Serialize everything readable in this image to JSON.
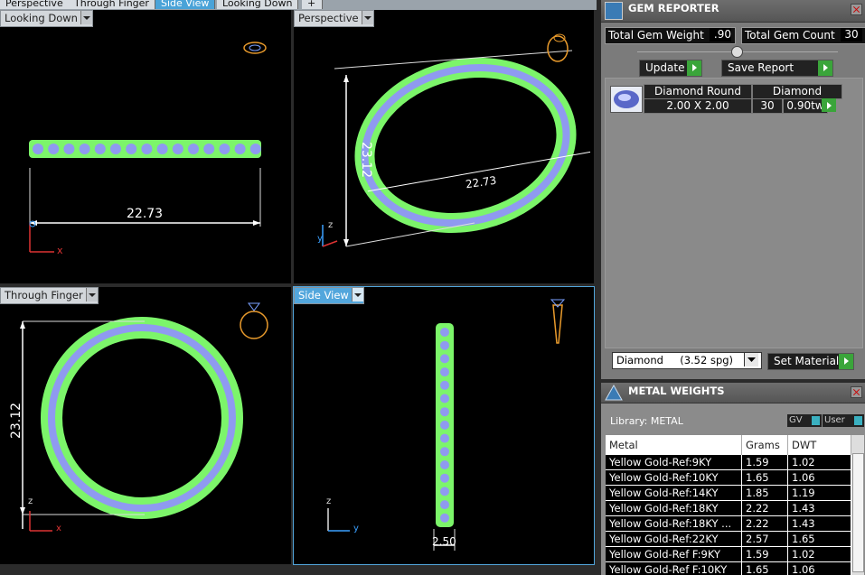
{
  "tabs": [
    {
      "label": "Perspective",
      "active": false
    },
    {
      "label": "Through Finger",
      "active": false
    },
    {
      "label": "Side View",
      "active": true
    },
    {
      "label": "Looking Down",
      "active": false
    }
  ],
  "viewports": {
    "top_left": {
      "label": "Looking Down",
      "dimension": "22.73",
      "axis_x": "x"
    },
    "top_right": {
      "label": "Perspective",
      "dimension_vertical": "23.12",
      "dimension_horizontal": "22.73",
      "axis_z": "z",
      "axis_y": "y"
    },
    "bottom_left": {
      "label": "Through Finger",
      "dimension": "23.12",
      "axis_z": "z",
      "axis_x": "x"
    },
    "bottom_right": {
      "label": "Side View",
      "dimension": "2.50",
      "axis_z": "z",
      "axis_y": "y"
    }
  },
  "gem_reporter": {
    "title": "GEM REPORTER",
    "total_weight_label": "Total Gem Weight",
    "total_weight_value": ".90",
    "total_count_label": "Total Gem Count",
    "total_count_value": "30",
    "update_label": "Update",
    "save_label": "Save Report",
    "gem": {
      "shape": "Diamond Round",
      "material": "Diamond",
      "size": "2.00 X 2.00",
      "count": "30",
      "weight": "0.90tw"
    },
    "material_select": "Diamond     (3.52 spg)",
    "set_material_label": "Set Material"
  },
  "metal_weights": {
    "title": "METAL WEIGHTS",
    "library": "Library: METAL",
    "gv_label": "GV",
    "user_label": "User",
    "columns": [
      "Metal",
      "Grams",
      "DWT"
    ],
    "rows": [
      [
        "Yellow Gold-Ref:9KY",
        "1.59",
        "1.02"
      ],
      [
        "Yellow Gold-Ref:10KY",
        "1.65",
        "1.06"
      ],
      [
        "Yellow Gold-Ref:14KY",
        "1.85",
        "1.19"
      ],
      [
        "Yellow Gold-Ref:18KY",
        "2.22",
        "1.43"
      ],
      [
        "Yellow Gold-Ref:18KY ...",
        "2.22",
        "1.43"
      ],
      [
        "Yellow Gold-Ref:22KY",
        "2.57",
        "1.65"
      ],
      [
        "Yellow Gold-Ref F:9KY",
        "1.59",
        "1.02"
      ],
      [
        "Yellow Gold-Ref F:10KY",
        "1.65",
        "1.06"
      ]
    ]
  },
  "colors": {
    "ring": "#7cf56a",
    "gem": "#8f9af0",
    "viewport_active": "#52a6dc",
    "go_button": "#3aa53a"
  }
}
